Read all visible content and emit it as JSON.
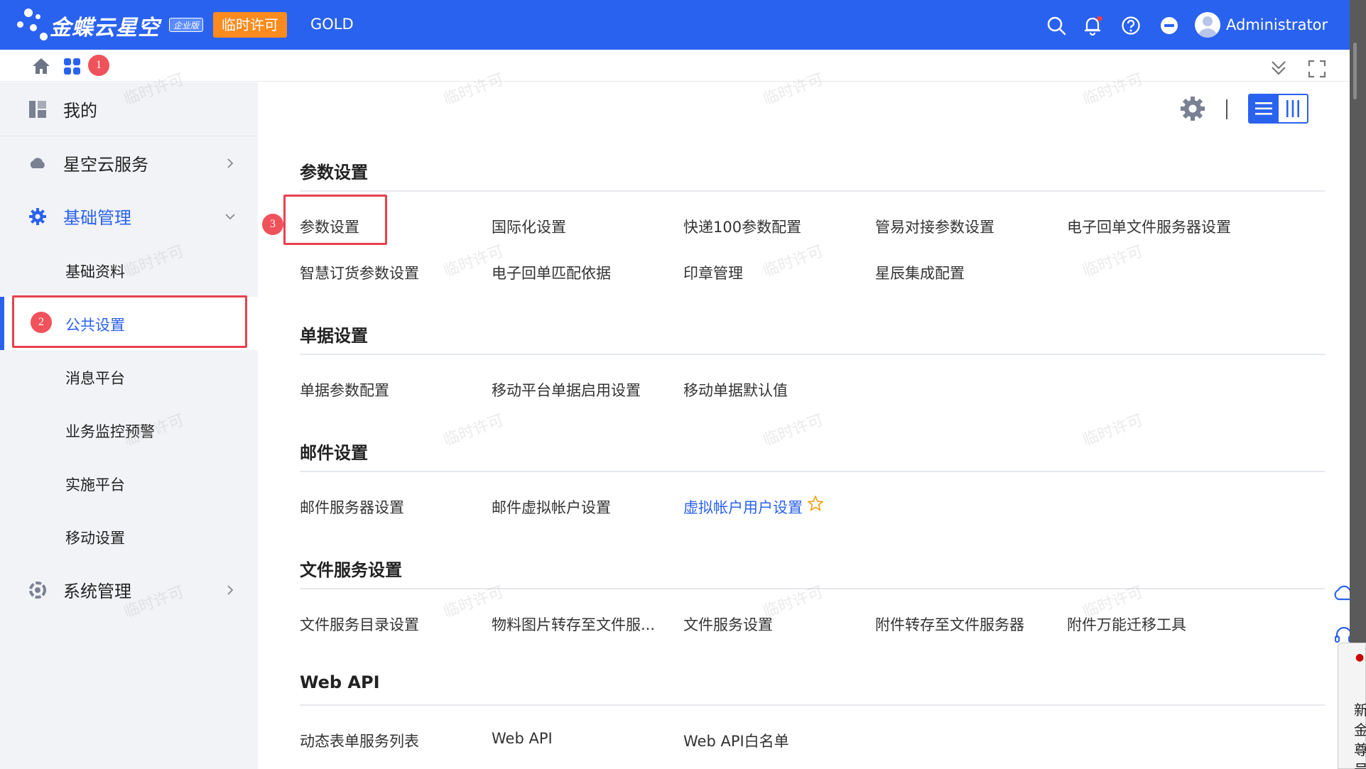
{
  "header": {
    "brand": "金蝶云星空",
    "edition_badge": "企业版",
    "license_button": "临时许可",
    "product_tier": "GOLD",
    "user_name": "Administrator",
    "accent_color": "#2a62f0"
  },
  "subbar": {
    "annotation_1": "1"
  },
  "sidebar": {
    "items": [
      {
        "label": "我的",
        "icon": "dashboard-icon"
      },
      {
        "label": "星空云服务",
        "icon": "cloud-service-icon"
      },
      {
        "label": "基础管理",
        "icon": "gear-icon"
      },
      {
        "label": "系统管理",
        "icon": "system-icon"
      }
    ],
    "sub_items": [
      {
        "label": "基础资料"
      },
      {
        "label": "公共设置"
      },
      {
        "label": "消息平台"
      },
      {
        "label": "业务监控预警"
      },
      {
        "label": "实施平台"
      },
      {
        "label": "移动设置"
      }
    ],
    "annotation_2": "2"
  },
  "main": {
    "annotation_3": "3",
    "sections": [
      {
        "title": "参数设置",
        "links": [
          "参数设置",
          "国际化设置",
          "快递100参数配置",
          "管易对接参数设置",
          "电子回单文件服务器设置",
          "智慧订货参数设置",
          "电子回单匹配依据",
          "印章管理",
          "星辰集成配置"
        ]
      },
      {
        "title": "单据设置",
        "links": [
          "单据参数配置",
          "移动平台单据启用设置",
          "移动单据默认值"
        ]
      },
      {
        "title": "邮件设置",
        "links": [
          "邮件服务器设置",
          "邮件虚拟帐户设置",
          "虚拟帐户用户设置"
        ]
      },
      {
        "title": "文件服务设置",
        "links": [
          "文件服务目录设置",
          "物料图片转存至文件服...",
          "文件服务设置",
          "附件转存至文件服务器",
          "附件万能迁移工具"
        ]
      },
      {
        "title": "Web API",
        "links": [
          "动态表单服务列表",
          "Web API",
          "Web API白名单"
        ]
      }
    ]
  },
  "watermark_text": "临时许可",
  "popup": {
    "chars": [
      "新",
      "金",
      "尊",
      "号"
    ]
  }
}
